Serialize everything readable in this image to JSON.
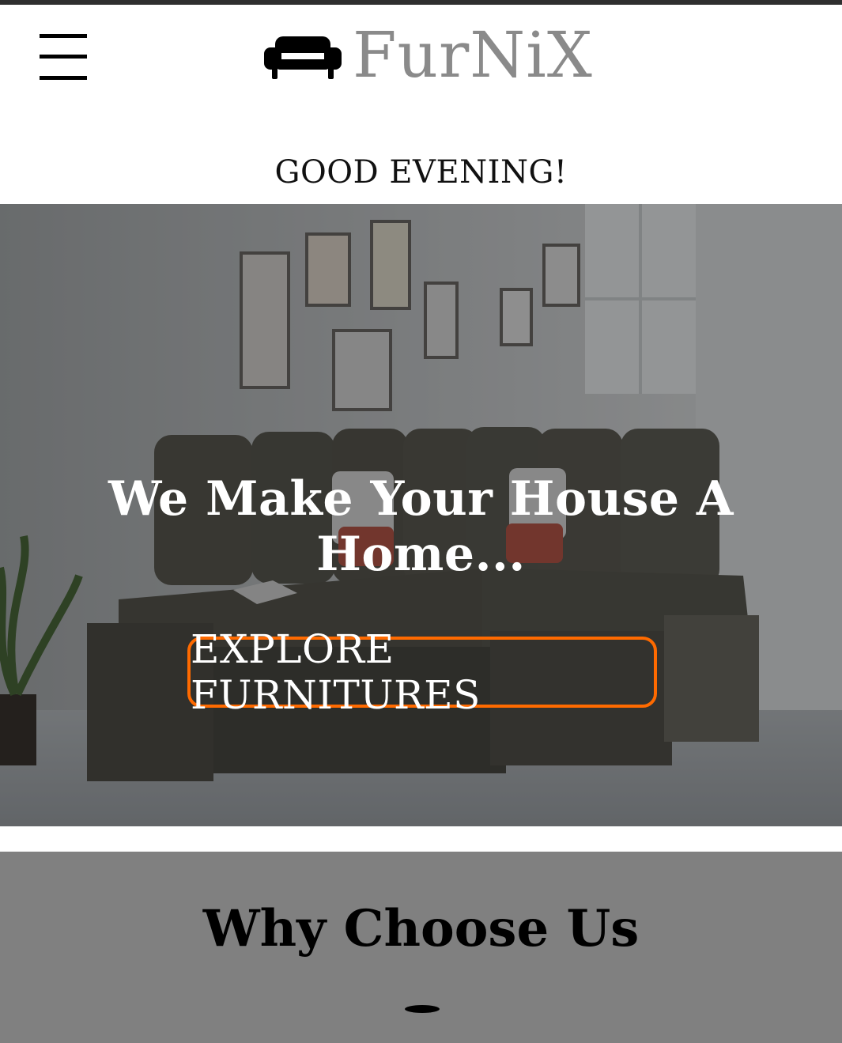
{
  "header": {
    "menu_icon": "hamburger-menu-icon",
    "logo_icon": "sofa-icon",
    "brand": "FurNiX"
  },
  "greeting": "GOOD EVENING!",
  "hero": {
    "title": "We Make Your House A Home...",
    "cta_label": "EXPLORE FURNITURES",
    "cta_border_color": "#ff6a00"
  },
  "why": {
    "title": "Why Choose Us",
    "background": "#808080"
  }
}
